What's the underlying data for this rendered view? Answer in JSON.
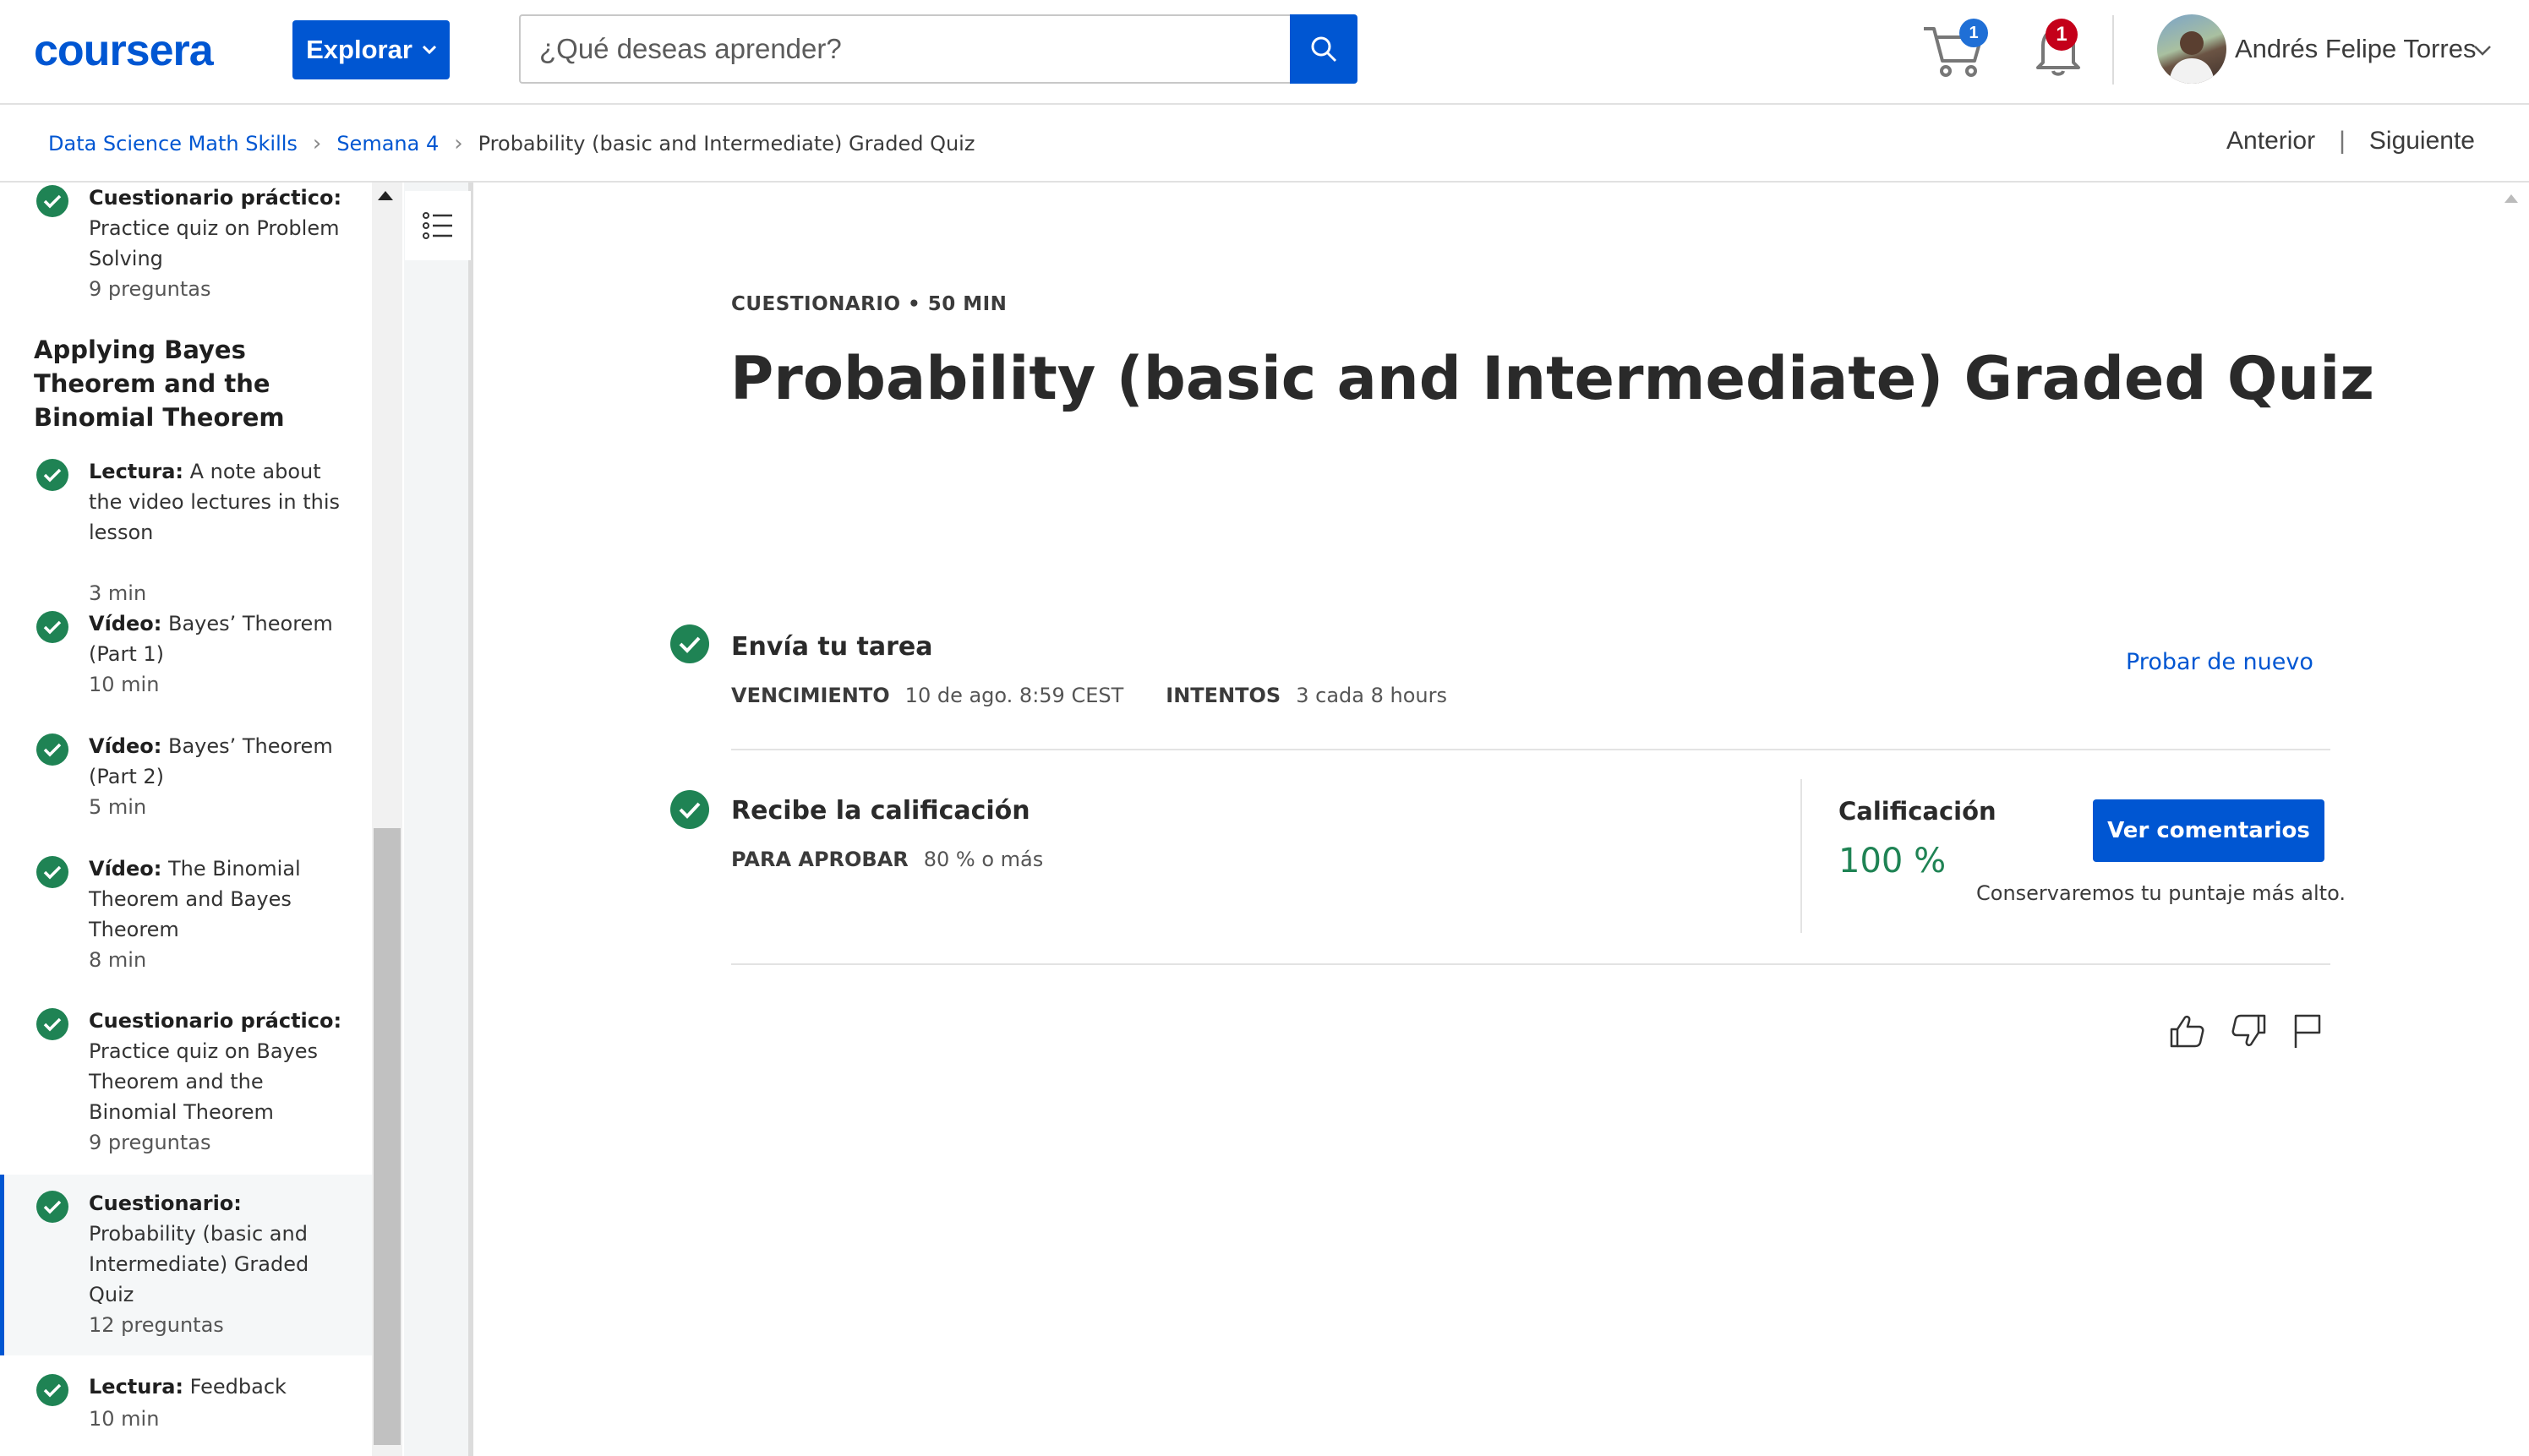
{
  "header": {
    "logo_text": "coursera",
    "explore_label": "Explorar",
    "search_placeholder": "¿Qué deseas aprender?",
    "cart_count": "1",
    "notification_count": "1",
    "user_name": "Andrés Felipe Torres",
    "brand_color": "#0056d2"
  },
  "breadcrumb": {
    "items": [
      "Data Science Math Skills",
      "Semana 4"
    ],
    "current": "Probability (basic and Intermediate) Graded Quiz",
    "prev_label": "Anterior",
    "separator": "|",
    "next_label": "Siguiente"
  },
  "sidebar": {
    "section_title": "Applying Bayes Theorem and the Binomial Theorem",
    "items": [
      {
        "type": "Cuestionario práctico:",
        "title": "Practice quiz on Problem Solving",
        "meta": "9 preguntas",
        "completed": true
      },
      {
        "type": "Lectura:",
        "title": "A note about the video lectures in this lesson",
        "meta": "3 min",
        "completed": true
      },
      {
        "type": "Vídeo:",
        "title": "Bayes’ Theorem (Part 1)",
        "meta": "10 min",
        "completed": true
      },
      {
        "type": "Vídeo:",
        "title": "Bayes’ Theorem (Part 2)",
        "meta": "5 min",
        "completed": true
      },
      {
        "type": "Vídeo:",
        "title": "The Binomial Theorem and Bayes Theorem",
        "meta": "8 min",
        "completed": true
      },
      {
        "type": "Cuestionario práctico:",
        "title": "Practice quiz on Bayes Theorem and the Binomial Theorem",
        "meta": "9 preguntas",
        "completed": true
      },
      {
        "type": "Cuestionario:",
        "title": "Probability (basic and Intermediate) Graded Quiz",
        "meta": "12 preguntas",
        "completed": true,
        "active": true
      },
      {
        "type": "Lectura:",
        "title": "Feedback",
        "meta": "10 min",
        "completed": true
      }
    ]
  },
  "main": {
    "eyebrow": "CUESTIONARIO • 50 MIN",
    "title": "Probability (basic and Intermediate) Graded Quiz",
    "submit": {
      "title": "Envía tu tarea",
      "due_label": "VENCIMIENTO",
      "due_value": "10 de ago. 8:59 CEST",
      "attempts_label": "INTENTOS",
      "attempts_value": "3 cada 8 hours",
      "retry_label": "Probar de nuevo"
    },
    "receive": {
      "title": "Recibe la calificación",
      "pass_label": "PARA APROBAR",
      "pass_value": "80 % o más"
    },
    "grade": {
      "label": "Calificación",
      "value": "100 %",
      "button_label": "Ver comentarios",
      "note": "Conservaremos tu puntaje más alto."
    }
  },
  "colors": {
    "success_green": "#1f8354",
    "accent_blue": "#0056d2",
    "alert_red": "#c4001a"
  }
}
